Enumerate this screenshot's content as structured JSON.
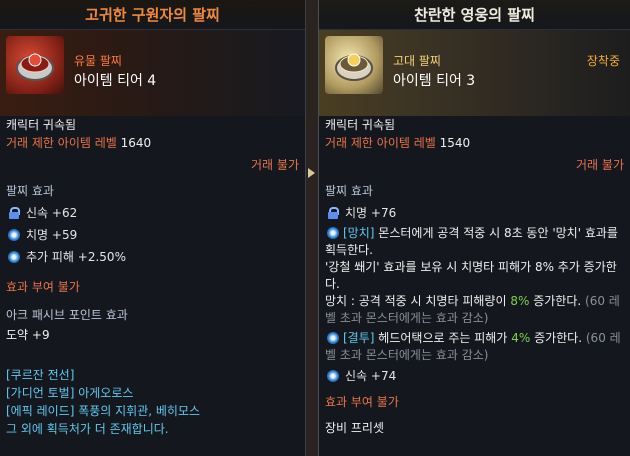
{
  "left": {
    "title": "고귀한 구원자의 팔찌",
    "grade": "유물 팔찌",
    "tier": "아이템 티어 4",
    "bound": "캐릭터 귀속됨",
    "trade_limit_label": "거래 제한 아이템 레벨",
    "trade_limit_value": "1640",
    "no_trade": "거래 불가",
    "bracelet_effect": "팔찌 효과",
    "stats": [
      {
        "icon": "lock-icon",
        "text": "신속 +62"
      },
      {
        "icon": "swirl-icon",
        "text": "치명 +59"
      },
      {
        "icon": "swirl-icon",
        "text": "추가 피해 +2.50%"
      }
    ],
    "no_grant": "효과 부여 불가",
    "ark_passive": "아크 패시브 포인트 효과",
    "leap": "도약 +9",
    "sources": [
      "[쿠르잔 전선]",
      "[가디언 토벌] 아게오로스",
      "[에픽 레이드] 폭풍의 지휘관, 베히모스",
      "그 외에 획득처가 더 존재합니다."
    ]
  },
  "right": {
    "title": "찬란한 영웅의 팔찌",
    "grade": "고대 팔찌",
    "tier": "아이템 티어 3",
    "equipped": "장착중",
    "bound": "캐릭터 귀속됨",
    "trade_limit_label": "거래 제한 아이템 레벨",
    "trade_limit_value": "1540",
    "no_trade": "거래 불가",
    "bracelet_effect": "팔찌 효과",
    "stat1": "치명 +76",
    "effect1_tag": "[망치]",
    "effect1_text": "몬스터에게 공격 적중 시 8초 동안 '망치' 효과를 획득한다.",
    "effect1_line2": "'강철 쐐기' 효과를 보유 시 치명타 피해가 8% 추가 증가한다.",
    "effect1_line3a": "망치 : 공격 적중 시 치명타 피해량이",
    "effect1_line3_pct": "8%",
    "effect1_line3b": "증가한다.",
    "effect1_line3c": "(60 레벨 초과 몬스터에게는 효과 감소)",
    "effect2_tag": "[결투]",
    "effect2_text_a": "헤드어택으로 주는 피해가",
    "effect2_pct": "4%",
    "effect2_text_b": "증가한다.",
    "effect2_note": "(60 레벨 초과 몬스터에게는 효과 감소)",
    "stat2": "신속 +74",
    "no_grant": "효과 부여 불가",
    "preset": "장비 프리셋"
  }
}
